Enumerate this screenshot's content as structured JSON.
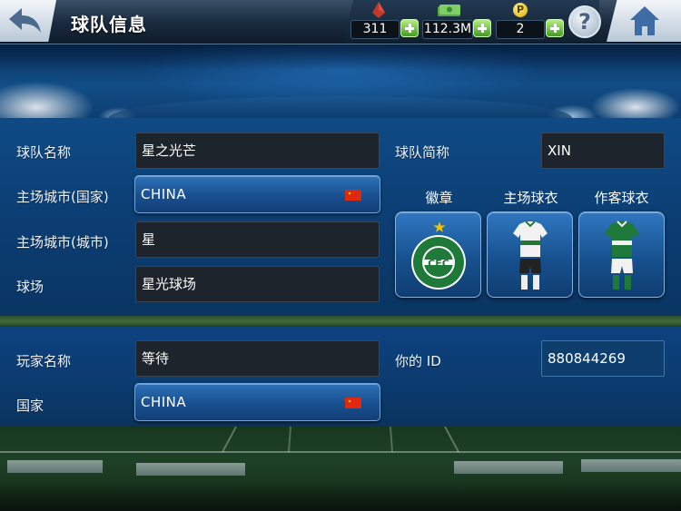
{
  "header": {
    "title": "球队信息",
    "resources": [
      {
        "name": "player-cards",
        "icon": "card-icon",
        "value": "311"
      },
      {
        "name": "money",
        "icon": "cash-icon",
        "value": "112.3M"
      },
      {
        "name": "points",
        "icon": "coin-p-icon",
        "value": "2",
        "icon_text": "P"
      }
    ],
    "help_label": "?"
  },
  "team": {
    "name_label": "球队名称",
    "name_value": "星之光芒",
    "short_label": "球队简称",
    "short_value": "XIN",
    "home_country_label": "主场城市(国家)",
    "home_country_value": "CHINA",
    "home_city_label": "主场城市(城市)",
    "home_city_value": "星",
    "stadium_label": "球场",
    "stadium_value": "星光球场",
    "badge_label": "徽章",
    "home_kit_label": "主场球衣",
    "away_kit_label": "作客球衣",
    "badge": {
      "top": "CORITIBA FOOT BALL CLUB",
      "center": "CFC",
      "bottom": "PARANÁ"
    }
  },
  "player": {
    "name_label": "玩家名称",
    "name_value": "等待",
    "id_label": "你的 ID",
    "id_value": "880844269",
    "country_label": "国家",
    "country_value": "CHINA"
  },
  "colors": {
    "accent": "#2e72b8",
    "field_dark": "#1e242b",
    "plus_green": "#3f9e1f",
    "kit_green": "#1f7a3a"
  }
}
